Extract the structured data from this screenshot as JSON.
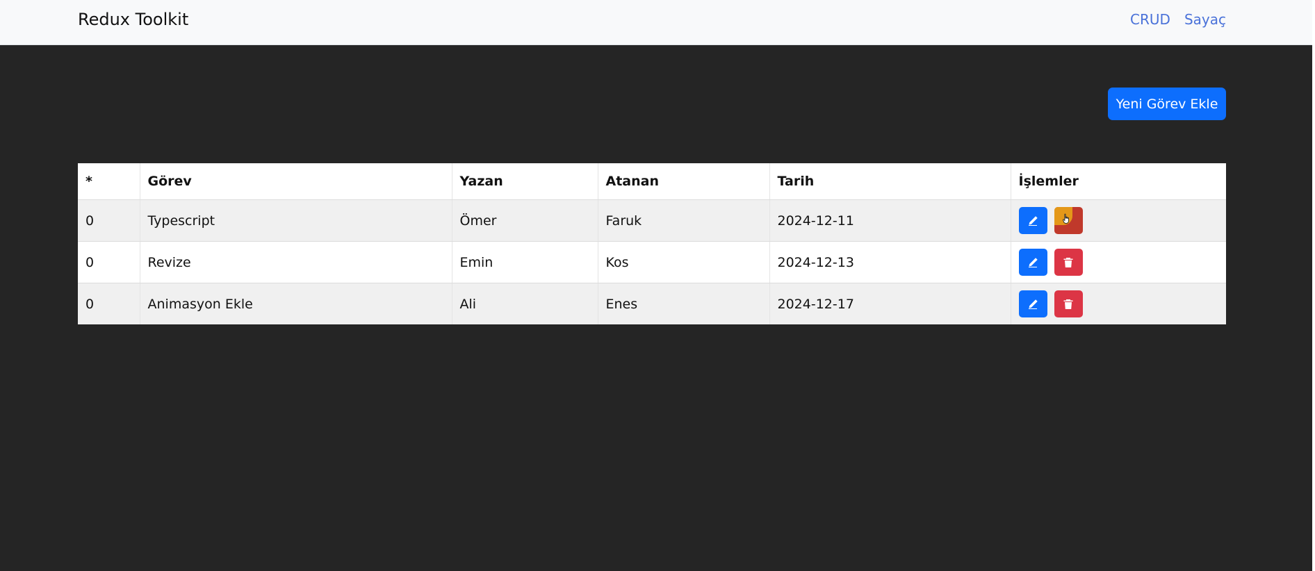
{
  "navbar": {
    "brand": "Redux Toolkit",
    "links": [
      "CRUD",
      "Sayaç"
    ]
  },
  "toolbar": {
    "add_label": "Yeni Görev Ekle"
  },
  "table": {
    "headers": [
      "*",
      "Görev",
      "Yazan",
      "Atanan",
      "Tarih",
      "İşlemler"
    ],
    "rows": [
      {
        "id": "0",
        "task": "Typescript",
        "author": "Ömer",
        "assignee": "Faruk",
        "date": "2024-12-11"
      },
      {
        "id": "0",
        "task": "Revize",
        "author": "Emin",
        "assignee": "Kos",
        "date": "2024-12-13"
      },
      {
        "id": "0",
        "task": "Animasyon Ekle",
        "author": "Ali",
        "assignee": "Enes",
        "date": "2024-12-17"
      }
    ],
    "row_actions": [
      "pencil-icon",
      "trash-icon"
    ]
  },
  "colors": {
    "background": "#252525",
    "navbar": "#f8f9fa",
    "link": "#4a72d9",
    "primary": "#0d6efd",
    "danger": "#dc3545"
  }
}
